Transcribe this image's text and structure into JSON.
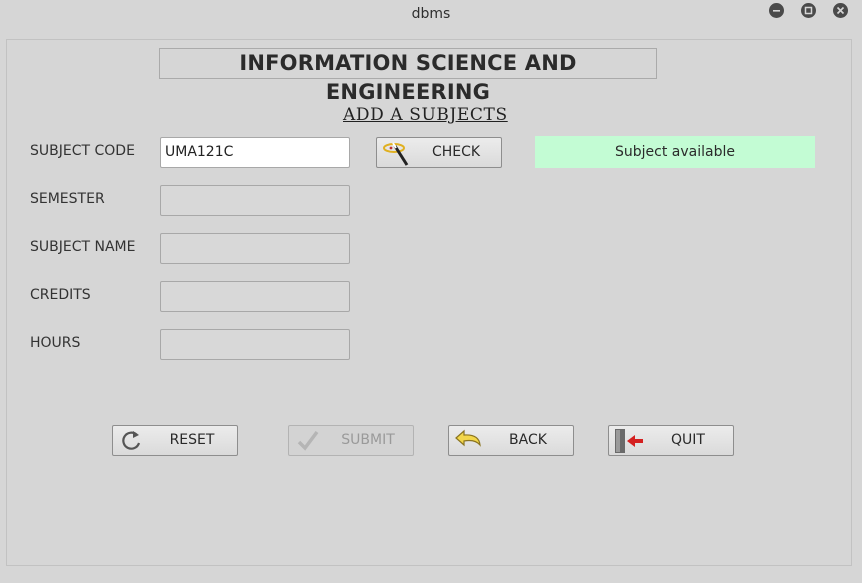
{
  "window": {
    "title": "dbms"
  },
  "header": {
    "main_title": "INFORMATION SCIENCE AND ENGINEERING",
    "subtitle": "ADD A SUBJECTS"
  },
  "form": {
    "subject_code": {
      "label": "SUBJECT CODE",
      "value": "UMA121C"
    },
    "semester": {
      "label": "SEMESTER",
      "value": ""
    },
    "subject_name": {
      "label": "SUBJECT NAME",
      "value": ""
    },
    "credits": {
      "label": "CREDITS",
      "value": ""
    },
    "hours": {
      "label": "HOURS",
      "value": ""
    }
  },
  "check_button": {
    "label": "CHECK",
    "icon": "magic-wand-icon"
  },
  "status": {
    "text": "Subject available",
    "color": "#c3fcd4"
  },
  "actions": {
    "reset": {
      "label": "RESET",
      "icon": "reset-icon"
    },
    "submit": {
      "label": "SUBMIT",
      "icon": "checkmark-icon",
      "enabled": false
    },
    "back": {
      "label": "BACK",
      "icon": "back-arrow-icon"
    },
    "quit": {
      "label": "QUIT",
      "icon": "exit-door-icon"
    }
  }
}
